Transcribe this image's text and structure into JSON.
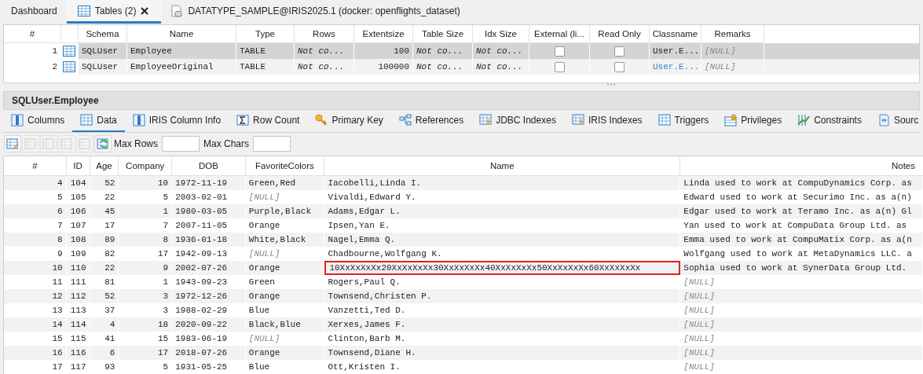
{
  "editor_tabs": [
    {
      "label": "Dashboard",
      "selected": false,
      "closable": false
    },
    {
      "label": "Tables (2)",
      "selected": true,
      "closable": true
    },
    {
      "label": "DATATYPE_SAMPLE@IRIS2025.1 (docker: openflights_dataset)",
      "selected": false,
      "closable": false
    }
  ],
  "tables_grid": {
    "columns": [
      "#",
      "Schema",
      "Name",
      "Type",
      "Rows",
      "Extentsize",
      "Table Size",
      "Idx Size",
      "External (li...",
      "Read Only",
      "Classname",
      "Remarks"
    ],
    "rows": [
      {
        "selected": true,
        "cells": [
          "1",
          "SQLUser",
          "Employee",
          "TABLE",
          {
            "v": "Not co...",
            "italic": true
          },
          "100",
          {
            "v": "Not co...",
            "italic": true
          },
          {
            "v": "Not co...",
            "italic": true
          },
          {
            "kind": "checkbox",
            "checked": false
          },
          {
            "kind": "checkbox",
            "checked": false
          },
          "User.E...",
          {
            "v": "[NULL]",
            "null": true
          }
        ]
      },
      {
        "selected": false,
        "cells": [
          "2",
          "SQLUser",
          "EmployeeOriginal",
          "TABLE",
          {
            "v": "Not co...",
            "italic": true
          },
          "100000",
          {
            "v": "Not co...",
            "italic": true
          },
          {
            "v": "Not co...",
            "italic": true
          },
          {
            "kind": "checkbox",
            "checked": false
          },
          {
            "kind": "checkbox",
            "checked": false
          },
          {
            "v": "User.E...",
            "link": true
          },
          {
            "v": "[NULL]",
            "null": true
          }
        ]
      }
    ]
  },
  "section_title": "SQLUser.Employee",
  "detail_tabs": [
    {
      "label": "Columns",
      "selected": false
    },
    {
      "label": "Data",
      "selected": true
    },
    {
      "label": "IRIS Column Info",
      "selected": false
    },
    {
      "label": "Row Count",
      "selected": false
    },
    {
      "label": "Primary Key",
      "selected": false
    },
    {
      "label": "References",
      "selected": false
    },
    {
      "label": "JDBC Indexes",
      "selected": false
    },
    {
      "label": "IRIS Indexes",
      "selected": false
    },
    {
      "label": "Triggers",
      "selected": false
    },
    {
      "label": "Privileges",
      "selected": false
    },
    {
      "label": "Constraints",
      "selected": false
    },
    {
      "label": "Sourc",
      "selected": false
    }
  ],
  "toolbar": {
    "buttons": [
      {
        "disabled": false
      },
      {
        "disabled": true
      },
      {
        "disabled": true
      },
      {
        "disabled": true
      },
      {
        "disabled": true
      },
      {
        "disabled": false
      }
    ],
    "max_rows_label": "Max Rows",
    "max_chars_label": "Max Chars"
  },
  "data_grid": {
    "columns": [
      "#",
      "ID",
      "Age",
      "Company",
      "DOB",
      "FavoriteColors",
      "Name",
      "Notes"
    ],
    "rows": [
      {
        "focused": false,
        "cells": [
          "4",
          "104",
          "52",
          "10",
          "1972-11-19",
          "Green,Red",
          "Iacobelli,Linda I.",
          "Linda used to work at CompuDynamics Corp. as"
        ]
      },
      {
        "focused": false,
        "cells": [
          "5",
          "105",
          "22",
          "5",
          "2003-02-01",
          {
            "v": "[NULL]",
            "null": true
          },
          "Vivaldi,Edward Y.",
          "Edward used to work at Securimo Inc. as a(n)"
        ]
      },
      {
        "focused": false,
        "cells": [
          "6",
          "106",
          "45",
          "1",
          "1980-03-05",
          "Purple,Black",
          "Adams,Edgar L.",
          "Edgar used to work at Teramo Inc. as a(n) Gl"
        ]
      },
      {
        "focused": false,
        "cells": [
          "7",
          "107",
          "17",
          "7",
          "2007-11-05",
          "Orange",
          "Ipsen,Yan E.",
          "Yan used to work at CompuData Group Ltd. as"
        ]
      },
      {
        "focused": false,
        "cells": [
          "8",
          "108",
          "89",
          "8",
          "1936-01-18",
          "White,Black",
          "Nagel,Emma Q.",
          "Emma used to work at CompuMatix Corp. as a(n"
        ]
      },
      {
        "focused": false,
        "cells": [
          "9",
          "109",
          "82",
          "17",
          "1942-09-13",
          {
            "v": "[NULL]",
            "null": true
          },
          "Chadbourne,Wolfgang K.",
          "Wolfgang used to work at MetaDynamics LLC. a"
        ]
      },
      {
        "focused": true,
        "cells": [
          "10",
          "110",
          "22",
          "9",
          "2002-07-26",
          "Orange",
          "10XxXxXxXx20XxXxXxXx30XxXxXxXx40XxXxXxXx50XxXxXxXx60XxXxXxXx",
          "Sophia used to work at SynerData Group Ltd."
        ]
      },
      {
        "focused": false,
        "cells": [
          "11",
          "111",
          "81",
          "1",
          "1943-09-23",
          "Green",
          "Rogers,Paul Q.",
          {
            "v": "[NULL]",
            "null": true
          }
        ]
      },
      {
        "focused": false,
        "cells": [
          "12",
          "112",
          "52",
          "3",
          "1972-12-26",
          "Orange",
          "Townsend,Christen P.",
          {
            "v": "[NULL]",
            "null": true
          }
        ]
      },
      {
        "focused": false,
        "cells": [
          "13",
          "113",
          "37",
          "3",
          "1988-02-29",
          "Blue",
          "Vanzetti,Ted D.",
          {
            "v": "[NULL]",
            "null": true
          }
        ]
      },
      {
        "focused": false,
        "cells": [
          "14",
          "114",
          "4",
          "18",
          "2020-09-22",
          "Black,Blue",
          "Xerxes,James F.",
          {
            "v": "[NULL]",
            "null": true
          }
        ]
      },
      {
        "focused": false,
        "cells": [
          "15",
          "115",
          "41",
          "15",
          "1983-06-19",
          {
            "v": "[NULL]",
            "null": true
          },
          "Clinton,Barb M.",
          {
            "v": "[NULL]",
            "null": true
          }
        ]
      },
      {
        "focused": false,
        "cells": [
          "16",
          "116",
          "6",
          "17",
          "2018-07-26",
          "Orange",
          "Townsend,Diane H.",
          {
            "v": "[NULL]",
            "null": true
          }
        ]
      },
      {
        "focused": false,
        "cells": [
          "17",
          "117",
          "93",
          "5",
          "1931-05-25",
          "Blue",
          "Ott,Kristen I.",
          {
            "v": "[NULL]",
            "null": true
          }
        ]
      }
    ]
  }
}
